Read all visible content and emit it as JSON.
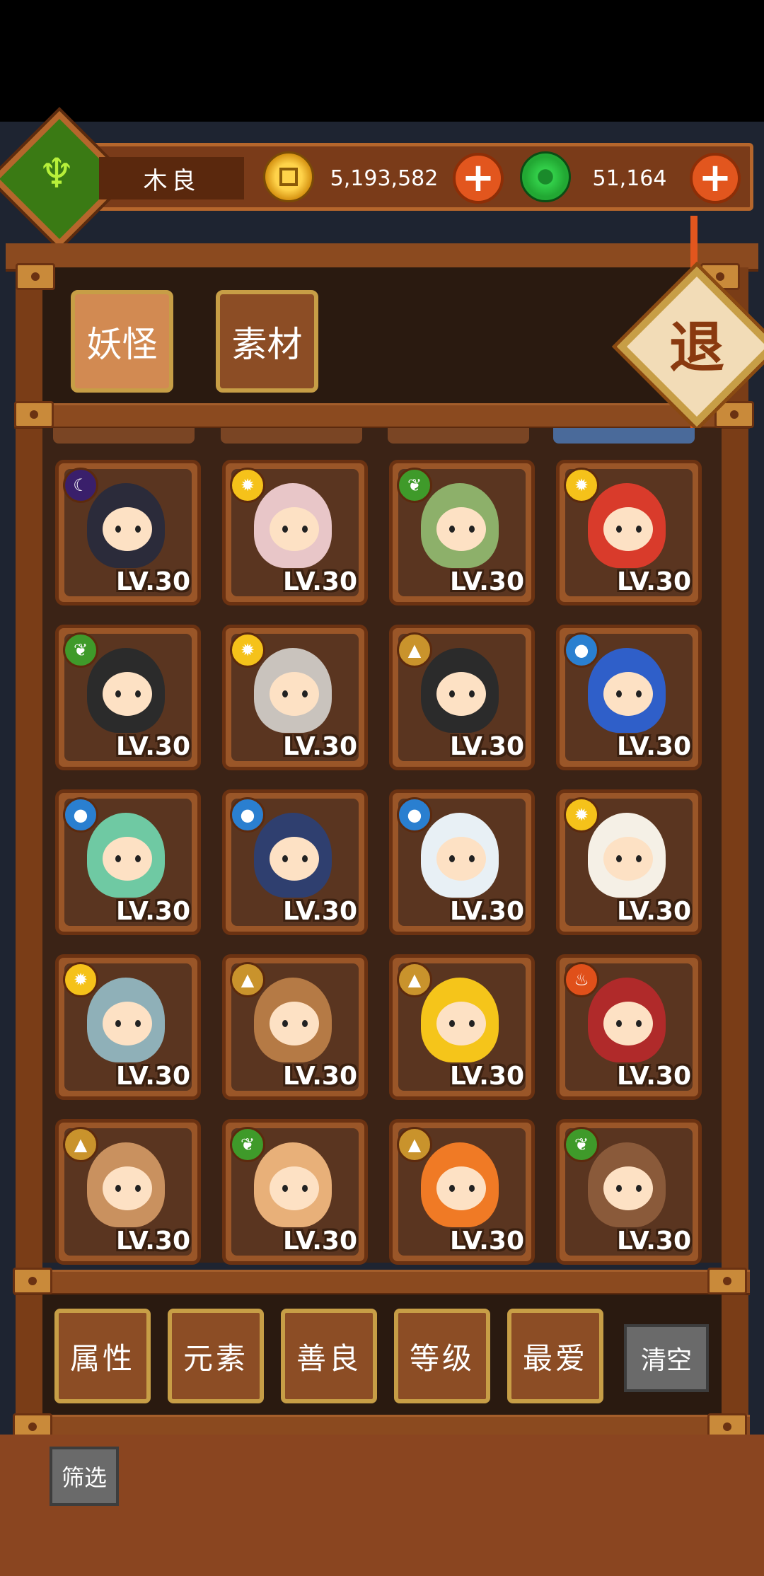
{
  "header": {
    "player_name": "木良",
    "gold": "5,193,582",
    "jade": "51,164",
    "plus_label": "+"
  },
  "tabs": [
    {
      "label": "妖怪",
      "active": true
    },
    {
      "label": "素材",
      "active": false
    }
  ],
  "exit_label": "退",
  "monsters": [
    {
      "element": "moon",
      "level": "LV.30",
      "color": "#2b2b3a"
    },
    {
      "element": "sun",
      "level": "LV.30",
      "color": "#e8c6c8"
    },
    {
      "element": "leaf",
      "level": "LV.30",
      "color": "#8db06a"
    },
    {
      "element": "sun",
      "level": "LV.30",
      "color": "#d93b2b"
    },
    {
      "element": "leaf",
      "level": "LV.30",
      "color": "#2b2b2b"
    },
    {
      "element": "sun",
      "level": "LV.30",
      "color": "#c9c3bd"
    },
    {
      "element": "earth",
      "level": "LV.30",
      "color": "#2b2b2b"
    },
    {
      "element": "water",
      "level": "LV.30",
      "color": "#2f5fc9"
    },
    {
      "element": "water",
      "level": "LV.30",
      "color": "#6fc9a3"
    },
    {
      "element": "water",
      "level": "LV.30",
      "color": "#2f3f6f"
    },
    {
      "element": "water",
      "level": "LV.30",
      "color": "#e8f0f5"
    },
    {
      "element": "sun",
      "level": "LV.30",
      "color": "#f5f0e6"
    },
    {
      "element": "sun",
      "level": "LV.30",
      "color": "#8fb0b8"
    },
    {
      "element": "earth",
      "level": "LV.30",
      "color": "#b57a45"
    },
    {
      "element": "earth",
      "level": "LV.30",
      "color": "#f5c51a"
    },
    {
      "element": "fire",
      "level": "LV.30",
      "color": "#b02a2a"
    },
    {
      "element": "earth",
      "level": "LV.30",
      "color": "#c9915f"
    },
    {
      "element": "leaf",
      "level": "LV.30",
      "color": "#e8b079"
    },
    {
      "element": "earth",
      "level": "LV.30",
      "color": "#f07a25"
    },
    {
      "element": "leaf",
      "level": "LV.30",
      "color": "#8a5a3a"
    }
  ],
  "element_colors": {
    "moon": "#3a1f6b",
    "sun": "#f5c21a",
    "leaf": "#3f9a2a",
    "earth": "#c9932c",
    "water": "#2a7fd0",
    "fire": "#e0501a"
  },
  "element_glyphs": {
    "moon": "☾",
    "sun": "✹",
    "leaf": "❦",
    "earth": "▲",
    "water": "●",
    "fire": "♨"
  },
  "filters": [
    "属性",
    "元素",
    "善良",
    "等级",
    "最爱"
  ],
  "clear_label": "清空",
  "screen_label": "筛选"
}
